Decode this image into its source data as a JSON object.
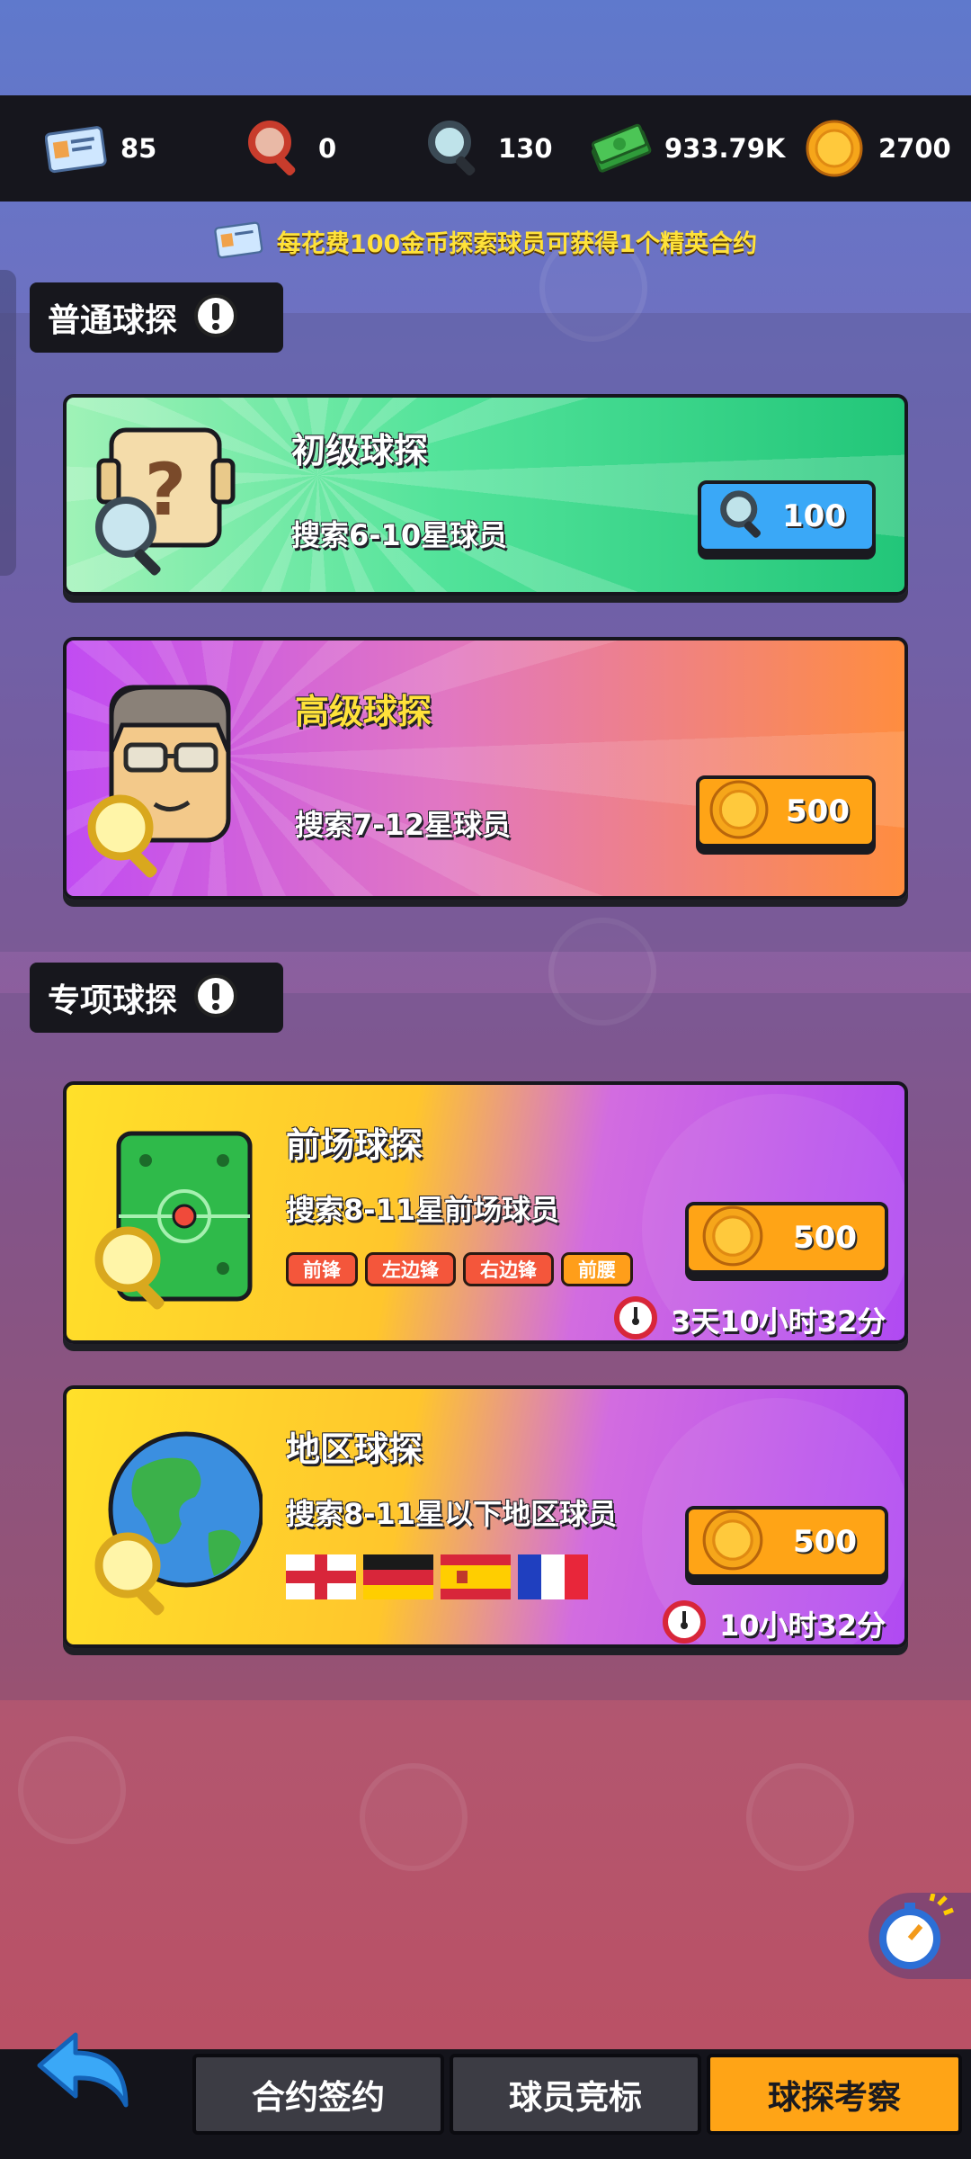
{
  "resources": [
    {
      "icon": "contract-card-icon",
      "value": "85"
    },
    {
      "icon": "red-magnifier-icon",
      "value": "0"
    },
    {
      "icon": "blue-magnifier-icon",
      "value": "130"
    },
    {
      "icon": "cash-stack-icon",
      "value": "933.79K"
    },
    {
      "icon": "gold-coin-icon",
      "value": "2700"
    }
  ],
  "notice": "每花费100金币探索球员可获得1个精英合约",
  "sections": {
    "normal": {
      "title": "普通球探",
      "info_icon": "exclamation-icon"
    },
    "special": {
      "title": "专项球探",
      "info_icon": "exclamation-icon"
    }
  },
  "cards": {
    "junior": {
      "title": "初级球探",
      "desc": "搜索6-10星球员",
      "cost": "100",
      "cost_icon": "blue-magnifier-icon"
    },
    "senior": {
      "title": "高级球探",
      "desc": "搜索7-12星球员",
      "cost": "500",
      "cost_icon": "gold-coin-icon"
    },
    "frontcourt": {
      "title": "前场球探",
      "desc": "搜索8-11星前场球员",
      "cost": "500",
      "positions": [
        "前锋",
        "左边锋",
        "右边锋",
        "前腰"
      ],
      "timer": "3天10小时32分"
    },
    "region": {
      "title": "地区球探",
      "desc": "搜索8-11星以下地区球员",
      "cost": "500",
      "flags": [
        "england-flag",
        "germany-flag",
        "spain-flag",
        "france-flag"
      ],
      "timer": "10小时32分"
    }
  },
  "nav": {
    "back": "back-arrow-icon",
    "tabs": [
      {
        "label": "合约签约",
        "active": false
      },
      {
        "label": "球员竞标",
        "active": false
      },
      {
        "label": "球探考察",
        "active": true
      }
    ]
  },
  "colors": {
    "accent_yellow": "#ffe23a",
    "active_tab": "#ffa416",
    "inactive_tab": "#3c3c44",
    "junior_card": "#3dd98f",
    "senior_card_left": "#c255f1",
    "senior_card_right": "#ff8e3a",
    "special_card_left": "#ffd928",
    "special_card_right": "#b144f2"
  }
}
